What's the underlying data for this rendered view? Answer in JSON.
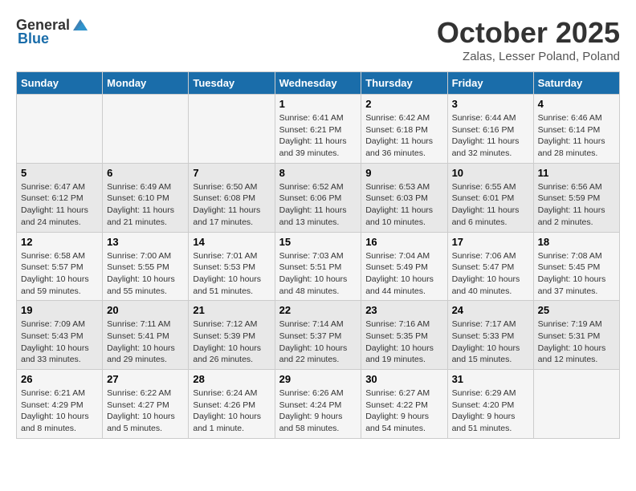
{
  "header": {
    "logo_general": "General",
    "logo_blue": "Blue",
    "month_title": "October 2025",
    "location": "Zalas, Lesser Poland, Poland"
  },
  "days_of_week": [
    "Sunday",
    "Monday",
    "Tuesday",
    "Wednesday",
    "Thursday",
    "Friday",
    "Saturday"
  ],
  "weeks": [
    [
      {
        "day": "",
        "info": ""
      },
      {
        "day": "",
        "info": ""
      },
      {
        "day": "",
        "info": ""
      },
      {
        "day": "1",
        "info": "Sunrise: 6:41 AM\nSunset: 6:21 PM\nDaylight: 11 hours\nand 39 minutes."
      },
      {
        "day": "2",
        "info": "Sunrise: 6:42 AM\nSunset: 6:18 PM\nDaylight: 11 hours\nand 36 minutes."
      },
      {
        "day": "3",
        "info": "Sunrise: 6:44 AM\nSunset: 6:16 PM\nDaylight: 11 hours\nand 32 minutes."
      },
      {
        "day": "4",
        "info": "Sunrise: 6:46 AM\nSunset: 6:14 PM\nDaylight: 11 hours\nand 28 minutes."
      }
    ],
    [
      {
        "day": "5",
        "info": "Sunrise: 6:47 AM\nSunset: 6:12 PM\nDaylight: 11 hours\nand 24 minutes."
      },
      {
        "day": "6",
        "info": "Sunrise: 6:49 AM\nSunset: 6:10 PM\nDaylight: 11 hours\nand 21 minutes."
      },
      {
        "day": "7",
        "info": "Sunrise: 6:50 AM\nSunset: 6:08 PM\nDaylight: 11 hours\nand 17 minutes."
      },
      {
        "day": "8",
        "info": "Sunrise: 6:52 AM\nSunset: 6:06 PM\nDaylight: 11 hours\nand 13 minutes."
      },
      {
        "day": "9",
        "info": "Sunrise: 6:53 AM\nSunset: 6:03 PM\nDaylight: 11 hours\nand 10 minutes."
      },
      {
        "day": "10",
        "info": "Sunrise: 6:55 AM\nSunset: 6:01 PM\nDaylight: 11 hours\nand 6 minutes."
      },
      {
        "day": "11",
        "info": "Sunrise: 6:56 AM\nSunset: 5:59 PM\nDaylight: 11 hours\nand 2 minutes."
      }
    ],
    [
      {
        "day": "12",
        "info": "Sunrise: 6:58 AM\nSunset: 5:57 PM\nDaylight: 10 hours\nand 59 minutes."
      },
      {
        "day": "13",
        "info": "Sunrise: 7:00 AM\nSunset: 5:55 PM\nDaylight: 10 hours\nand 55 minutes."
      },
      {
        "day": "14",
        "info": "Sunrise: 7:01 AM\nSunset: 5:53 PM\nDaylight: 10 hours\nand 51 minutes."
      },
      {
        "day": "15",
        "info": "Sunrise: 7:03 AM\nSunset: 5:51 PM\nDaylight: 10 hours\nand 48 minutes."
      },
      {
        "day": "16",
        "info": "Sunrise: 7:04 AM\nSunset: 5:49 PM\nDaylight: 10 hours\nand 44 minutes."
      },
      {
        "day": "17",
        "info": "Sunrise: 7:06 AM\nSunset: 5:47 PM\nDaylight: 10 hours\nand 40 minutes."
      },
      {
        "day": "18",
        "info": "Sunrise: 7:08 AM\nSunset: 5:45 PM\nDaylight: 10 hours\nand 37 minutes."
      }
    ],
    [
      {
        "day": "19",
        "info": "Sunrise: 7:09 AM\nSunset: 5:43 PM\nDaylight: 10 hours\nand 33 minutes."
      },
      {
        "day": "20",
        "info": "Sunrise: 7:11 AM\nSunset: 5:41 PM\nDaylight: 10 hours\nand 29 minutes."
      },
      {
        "day": "21",
        "info": "Sunrise: 7:12 AM\nSunset: 5:39 PM\nDaylight: 10 hours\nand 26 minutes."
      },
      {
        "day": "22",
        "info": "Sunrise: 7:14 AM\nSunset: 5:37 PM\nDaylight: 10 hours\nand 22 minutes."
      },
      {
        "day": "23",
        "info": "Sunrise: 7:16 AM\nSunset: 5:35 PM\nDaylight: 10 hours\nand 19 minutes."
      },
      {
        "day": "24",
        "info": "Sunrise: 7:17 AM\nSunset: 5:33 PM\nDaylight: 10 hours\nand 15 minutes."
      },
      {
        "day": "25",
        "info": "Sunrise: 7:19 AM\nSunset: 5:31 PM\nDaylight: 10 hours\nand 12 minutes."
      }
    ],
    [
      {
        "day": "26",
        "info": "Sunrise: 6:21 AM\nSunset: 4:29 PM\nDaylight: 10 hours\nand 8 minutes."
      },
      {
        "day": "27",
        "info": "Sunrise: 6:22 AM\nSunset: 4:27 PM\nDaylight: 10 hours\nand 5 minutes."
      },
      {
        "day": "28",
        "info": "Sunrise: 6:24 AM\nSunset: 4:26 PM\nDaylight: 10 hours\nand 1 minute."
      },
      {
        "day": "29",
        "info": "Sunrise: 6:26 AM\nSunset: 4:24 PM\nDaylight: 9 hours\nand 58 minutes."
      },
      {
        "day": "30",
        "info": "Sunrise: 6:27 AM\nSunset: 4:22 PM\nDaylight: 9 hours\nand 54 minutes."
      },
      {
        "day": "31",
        "info": "Sunrise: 6:29 AM\nSunset: 4:20 PM\nDaylight: 9 hours\nand 51 minutes."
      },
      {
        "day": "",
        "info": ""
      }
    ]
  ]
}
